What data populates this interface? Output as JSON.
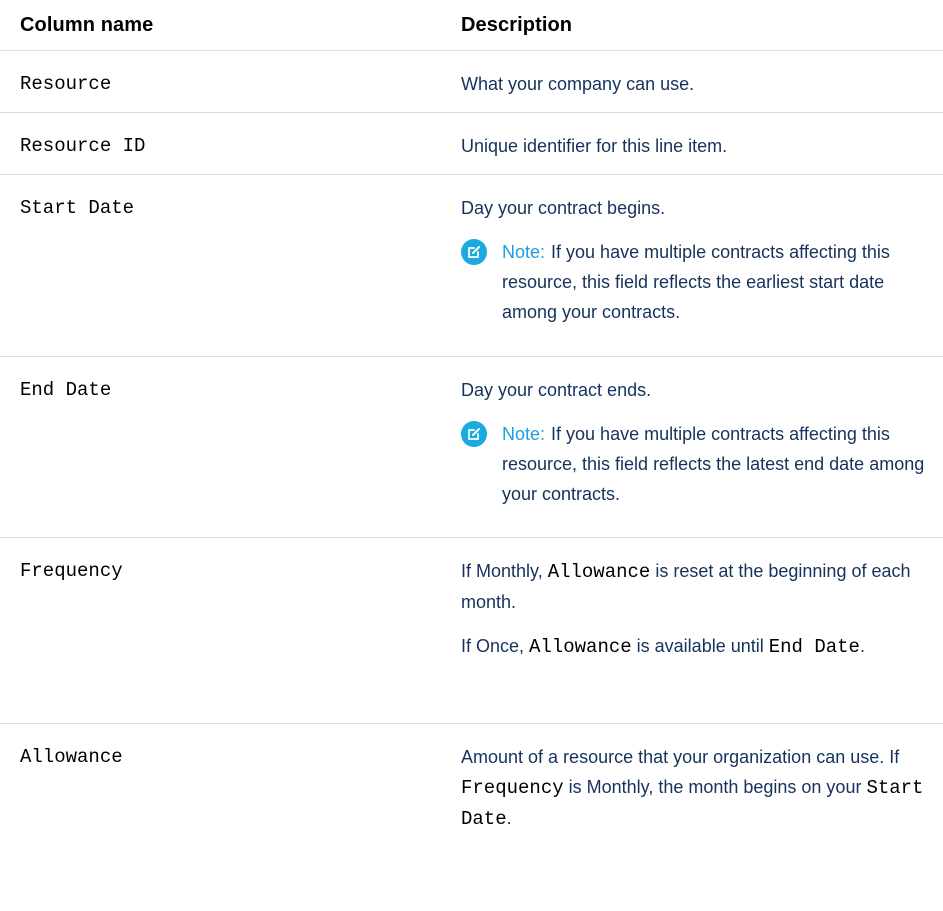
{
  "table": {
    "headers": {
      "name": "Column name",
      "description": "Description"
    },
    "rows": [
      {
        "name": "Resource",
        "description": "What your company can use."
      },
      {
        "name": "Resource ID",
        "description": "Unique identifier for this line item."
      },
      {
        "name": "Start Date",
        "description": "Day your contract begins.",
        "note_label": "Note:",
        "note_text": "If you have multiple contracts affecting this resource, this field reflects the earliest start date among your contracts."
      },
      {
        "name": "End Date",
        "description": "Day your contract ends.",
        "note_label": "Note:",
        "note_text": "If you have multiple contracts affecting this resource, this field reflects the latest end date among your contracts."
      },
      {
        "name": "Frequency",
        "p1_prefix": "If Monthly, ",
        "p1_code": "Allowance",
        "p1_suffix": " is reset at the beginning of each month.",
        "p2_prefix": "If Once, ",
        "p2_code1": "Allowance",
        "p2_mid": " is available until ",
        "p2_code2": "End Date",
        "p2_suffix": "."
      },
      {
        "name": "Allowance",
        "p1_prefix": "Amount of a resource that your organization can use. If ",
        "p1_code": "Frequency",
        "p1_mid": " is Monthly, the month begins on your ",
        "p1_code2": "Start Date",
        "p1_suffix": "."
      }
    ]
  },
  "colors": {
    "note_icon": "#1aaae0",
    "note_label": "#1aa1dc",
    "divider": "#d8dde6"
  },
  "icons": {
    "note": "edit-note-icon"
  }
}
